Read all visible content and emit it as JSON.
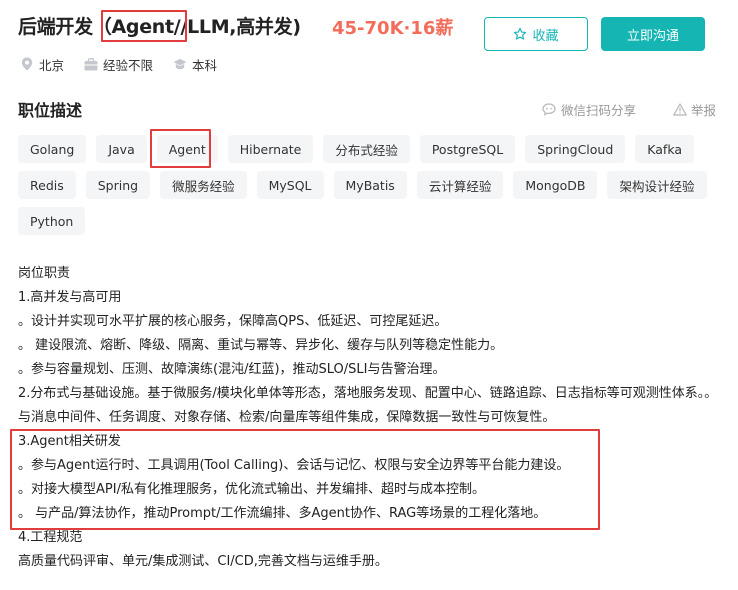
{
  "job": {
    "title": "后端开发（Agent//LLM,高并发)",
    "salary": "45-70K·16薪"
  },
  "actions": {
    "favorite_label": "收藏",
    "chat_label": "立即沟通"
  },
  "meta": {
    "location": "北京",
    "experience": "经验不限",
    "education": "本科"
  },
  "section": {
    "title": "职位描述",
    "share_label": "微信扫码分享",
    "report_label": "举报"
  },
  "tags": [
    "Golang",
    "Java",
    "Agent",
    "Hibernate",
    "分布式经验",
    "PostgreSQL",
    "SpringCloud",
    "Kafka",
    "Redis",
    "Spring",
    "微服务经验",
    "MySQL",
    "MyBatis",
    "云计算经验",
    "MongoDB",
    "架构设计经验",
    "Python"
  ],
  "description": [
    "岗位职责",
    "1.高并发与高可用",
    "。设计并实现可水平扩展的核心服务，保障高QPS、低延迟、可控尾延迟。",
    "。 建设限流、熔断、降级、隔离、重试与幂等、异步化、缓存与队列等稳定性能力。",
    "。参与容量规划、压测、故障演练(混沌/红蓝)，推动SLO/SLI与告警治理。",
    "2.分布式与基础设施。基于微服务/模块化单体等形态，落地服务发现、配置中心、链路追踪、日志指标等可观测性体系。。与消息中间件、任务调度、对象存储、检索/向量库等组件集成，保障数据一致性与可恢复性。",
    "3.Agent相关研发",
    "。参与Agent运行时、工具调用(Tool Calling)、会话与记忆、权限与安全边界等平台能力建设。",
    "。对接大模型API/私有化推理服务，优化流式输出、并发编排、超时与成本控制。",
    "。 与产品/算法协作，推动Prompt/工作流编排、多Agent协作、RAG等场景的工程化落地。",
    "4.工程规范",
    "高质量代码评审、单元/集成测试、CI/CD,完善文档与运维手册。"
  ],
  "colors": {
    "accent": "#14b5b2",
    "salary": "#f26d5b",
    "highlight": "#e23d3d",
    "tag_bg": "#f4f5f7"
  },
  "icons": {
    "favorite": "star-icon",
    "location": "location-pin-icon",
    "experience": "briefcase-icon",
    "education": "graduation-cap-icon",
    "share": "chat-bubble-icon",
    "report": "warning-icon"
  }
}
